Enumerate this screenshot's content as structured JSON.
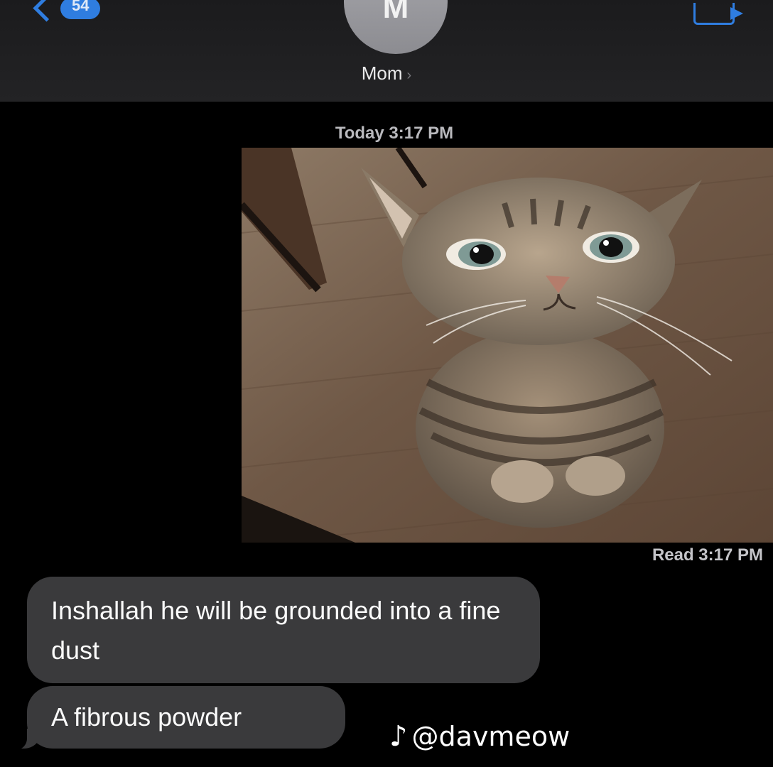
{
  "header": {
    "back_badge": "54",
    "avatar_initial": "M",
    "contact_name": "Mom",
    "contact_chevron": "›",
    "facetime_icon": "video-camera-icon"
  },
  "thread": {
    "timestamp": "Today 3:17 PM",
    "image_alt": "tabby cat sitting on wood floor looking up",
    "read_receipt": "Read 3:17 PM",
    "messages": [
      {
        "from": "Mom",
        "text": "Inshallah he will be grounded into a fine dust"
      },
      {
        "from": "Mom",
        "text": "A fibrous powder"
      }
    ]
  },
  "watermark": {
    "icon": "tiktok-note-icon",
    "glyph": "♪",
    "handle": "@davmeow"
  },
  "colors": {
    "accent": "#2f7de0",
    "bubble": "#3a3a3c",
    "background": "#000000"
  }
}
